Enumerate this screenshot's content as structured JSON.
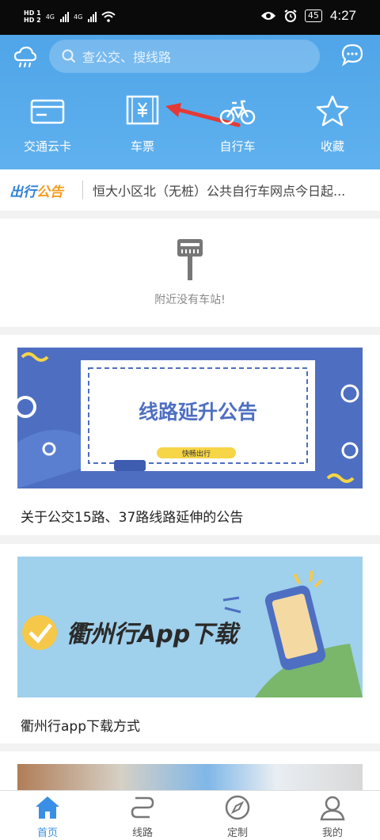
{
  "status_bar": {
    "hd1": "HD 1",
    "hd2": "HD 2",
    "net1": "4G",
    "net2": "4G",
    "battery": "45",
    "time": "4:27"
  },
  "header": {
    "search_placeholder": "查公交、搜线路",
    "colors": {
      "primary": "#4fa5e8",
      "accent": "#e53935"
    }
  },
  "quick_actions": [
    {
      "label": "交通云卡",
      "icon": "card-icon"
    },
    {
      "label": "车票",
      "icon": "ticket-icon"
    },
    {
      "label": "自行车",
      "icon": "bicycle-icon"
    },
    {
      "label": "收藏",
      "icon": "star-icon"
    }
  ],
  "notice": {
    "logo_part1": "出行",
    "logo_part2": "公告",
    "text": "恒大小区北（无桩）公共自行车网点今日起..."
  },
  "nearby": {
    "empty_text": "附近没有车站!"
  },
  "news": [
    {
      "banner_title": "线路延升公告",
      "banner_tag": "快畅出行",
      "title": "关于公交15路、37路线路延伸的公告"
    },
    {
      "banner_title": "衢州行App下载",
      "title": "衢州行app下载方式"
    }
  ],
  "tabs": [
    {
      "label": "首页",
      "active": true
    },
    {
      "label": "线路",
      "active": false
    },
    {
      "label": "定制",
      "active": false
    },
    {
      "label": "我的",
      "active": false
    }
  ]
}
